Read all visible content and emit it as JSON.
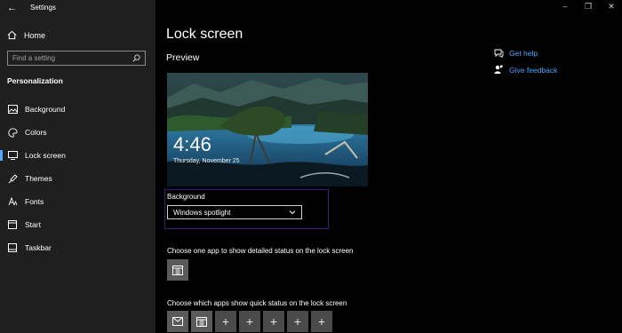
{
  "titlebar": {
    "app_title": "Settings",
    "back_icon": "back-arrow-icon",
    "minimize_glyph": "–",
    "maximize_glyph": "❐",
    "close_glyph": "✕"
  },
  "sidebar": {
    "home_label": "Home",
    "search_placeholder": "Find a setting",
    "section_title": "Personalization",
    "items": [
      {
        "label": "Background",
        "icon": "picture-icon"
      },
      {
        "label": "Colors",
        "icon": "palette-icon"
      },
      {
        "label": "Lock screen",
        "icon": "lock-screen-icon",
        "active": true
      },
      {
        "label": "Themes",
        "icon": "brush-icon"
      },
      {
        "label": "Fonts",
        "icon": "fonts-icon"
      },
      {
        "label": "Start",
        "icon": "start-icon"
      },
      {
        "label": "Taskbar",
        "icon": "taskbar-icon"
      }
    ],
    "accent_color": "#4da6ff"
  },
  "main": {
    "title": "Lock screen",
    "preview_label": "Preview",
    "preview_time": "4:46",
    "preview_date": "Thursday, November 25",
    "background_label": "Background",
    "background_value": "Windows spotlight",
    "detail_label": "Choose one app to show detailed status on the lock screen",
    "detail_app_icon": "calendar-icon",
    "quick_label": "Choose which apps show quick status on the lock screen",
    "quick_apps": [
      "mail-icon",
      "calendar-icon",
      "+",
      "+",
      "+",
      "+",
      "+"
    ]
  },
  "help": {
    "get_help": "Get help",
    "give_feedback": "Give feedback",
    "link_color": "#4da6ff"
  }
}
